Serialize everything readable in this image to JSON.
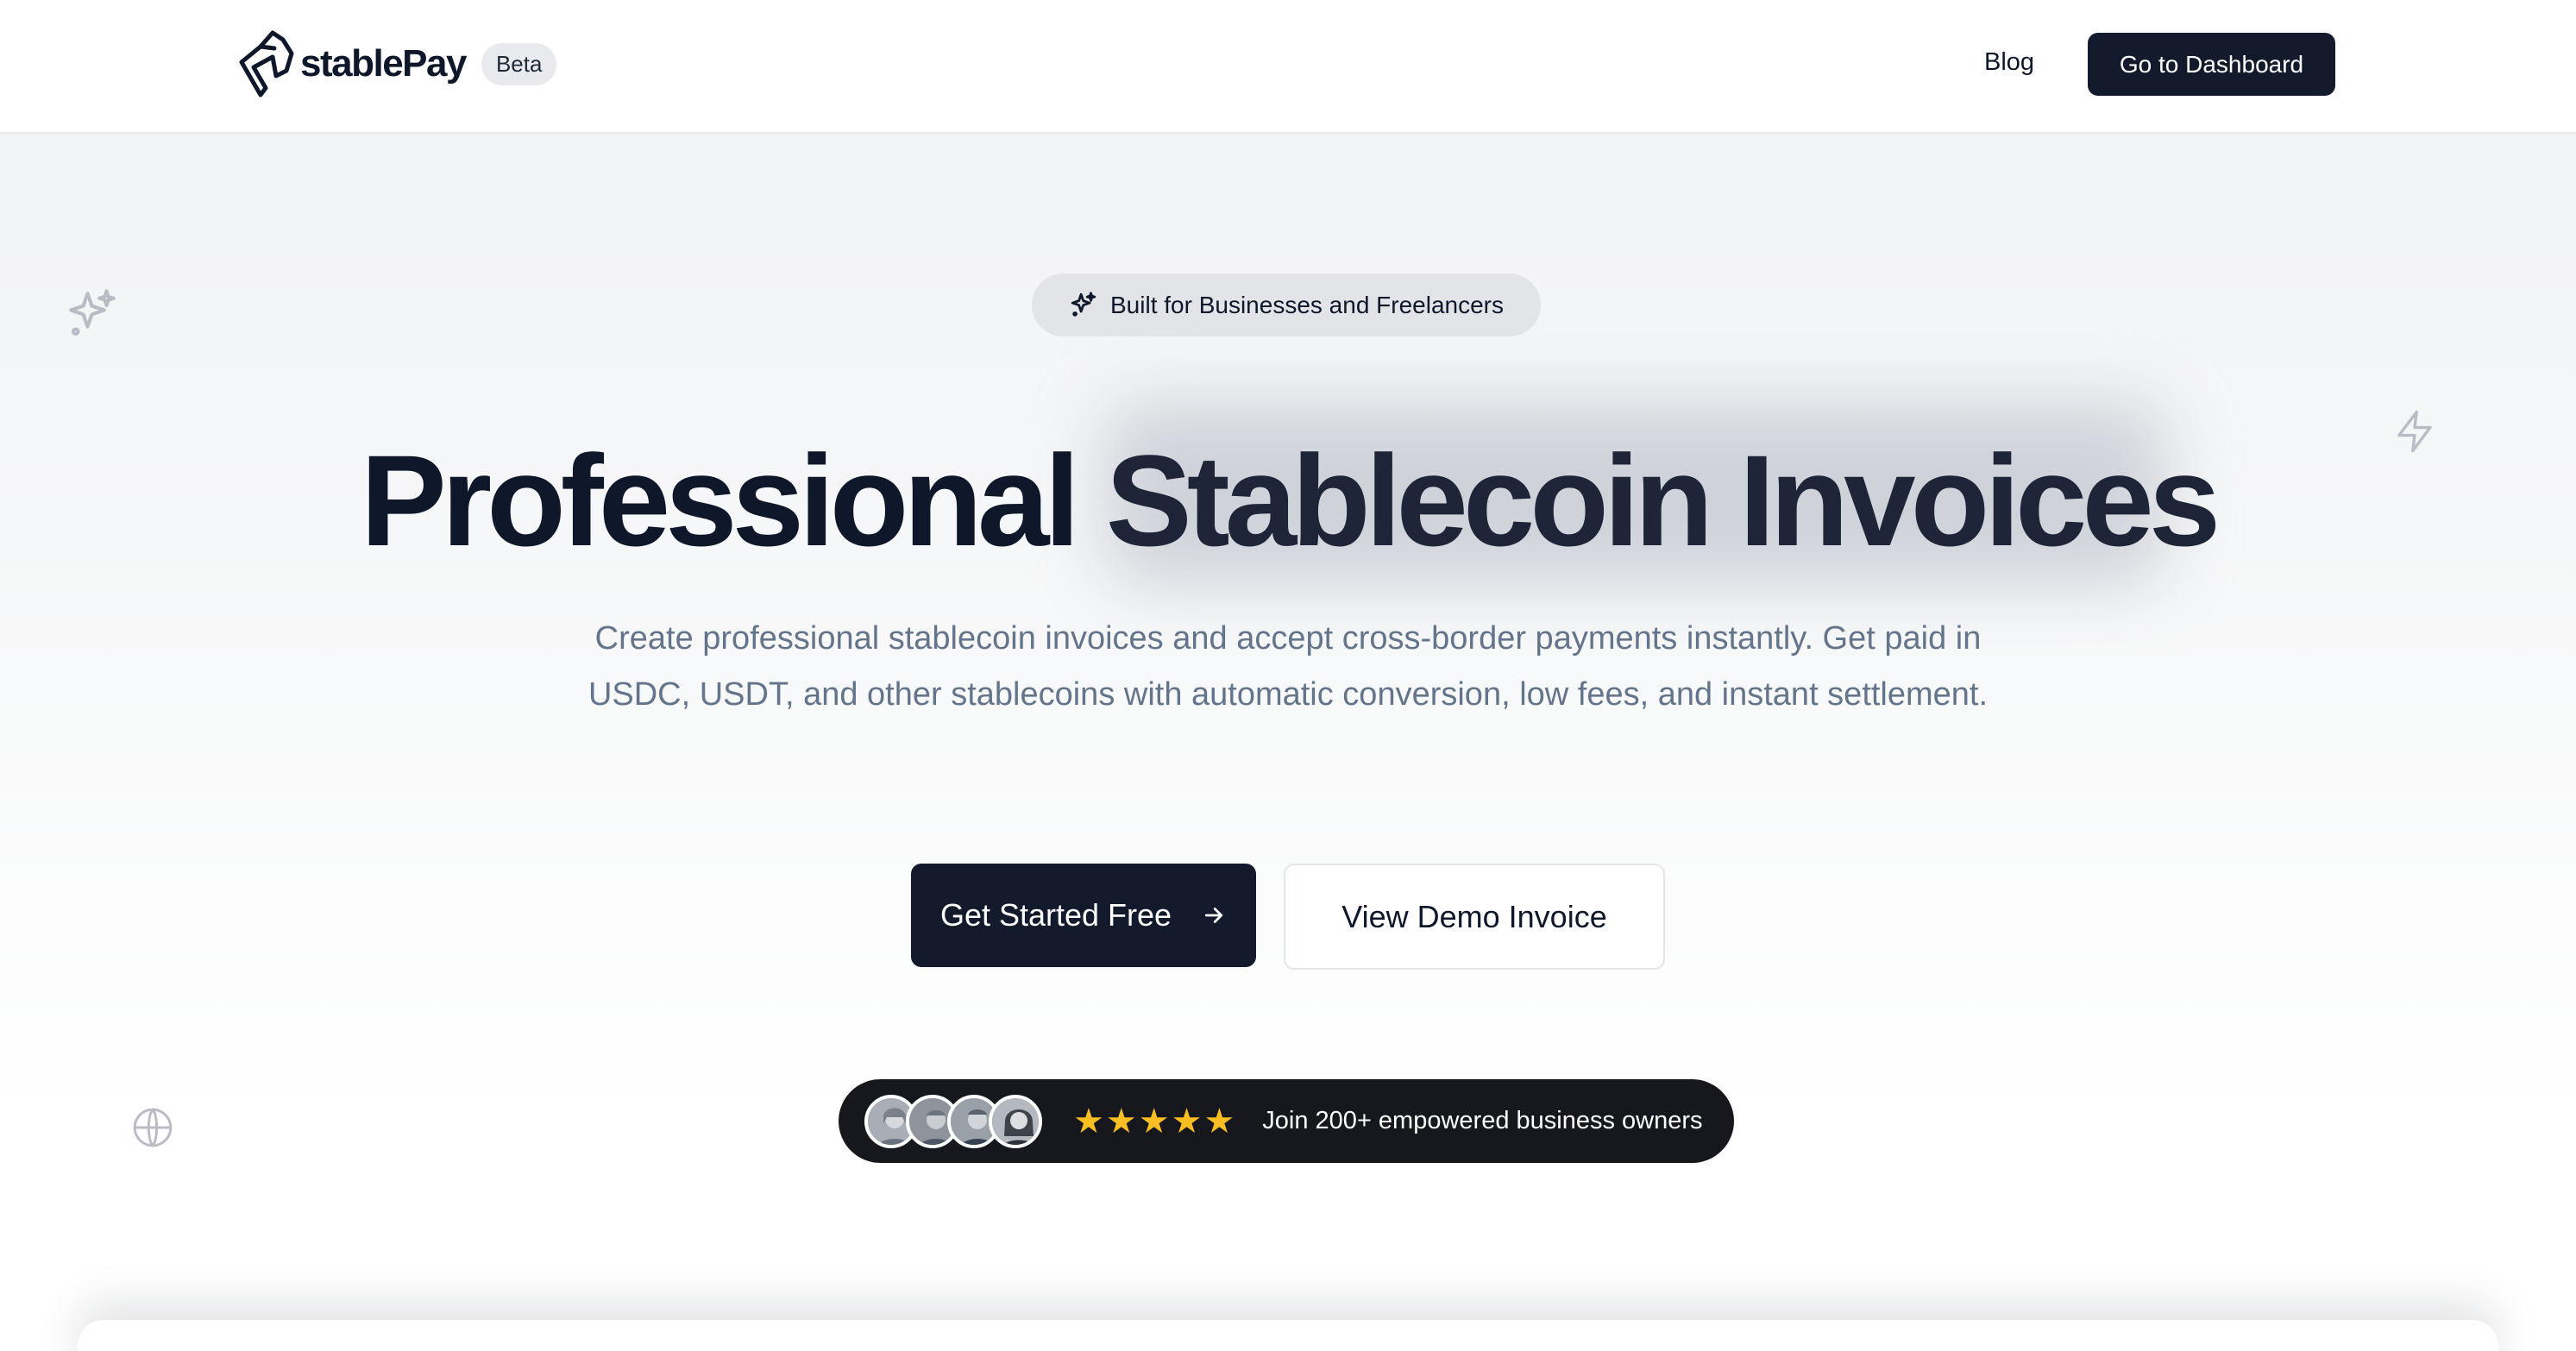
{
  "header": {
    "brand_name": "stablePay",
    "beta_label": "Beta",
    "nav_blog": "Blog",
    "dashboard_button": "Go to Dashboard"
  },
  "hero": {
    "pill_text": "Built for Businesses and Freelancers",
    "headline_part1": "Professional ",
    "headline_part2": "Stablecoin Invoices",
    "subcopy": "Create professional stablecoin invoices and accept cross-border payments instantly. Get paid in USDC, USDT, and other stablecoins with automatic conversion, low fees, and instant settlement.",
    "primary_cta": "Get Started Free",
    "secondary_cta": "View Demo Invoice"
  },
  "social_proof": {
    "stars": "★★★★★",
    "text": "Join 200+ empowered business owners",
    "avatar_count": 4
  },
  "colors": {
    "primary_dark": "#131a2c",
    "muted_text": "#64748b",
    "star": "#fbbf24",
    "pill_bg": "#e3e4e8"
  },
  "icons": {
    "logo": "horse-head-logo-icon",
    "pill": "sparkles-icon",
    "float_top_left": "sparkles-icon",
    "float_right": "lightning-icon",
    "float_bottom_left": "globe-icon",
    "cta_arrow": "arrow-right-icon"
  }
}
